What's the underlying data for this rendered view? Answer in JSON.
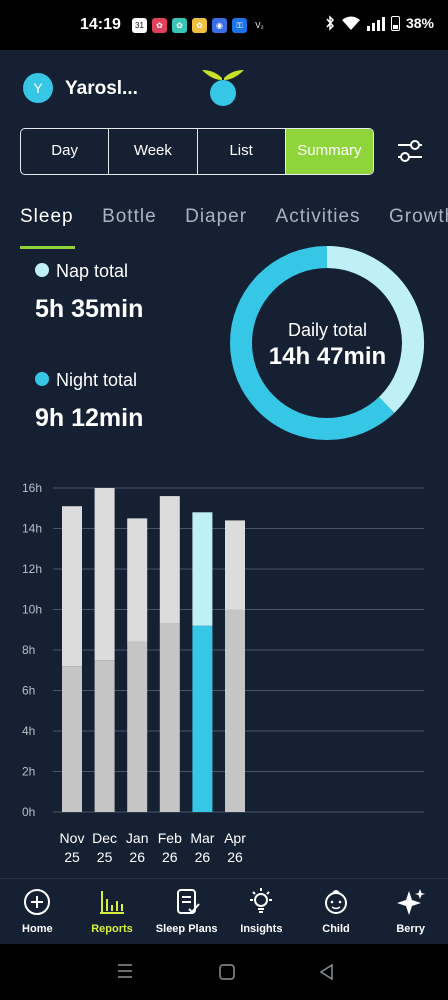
{
  "status": {
    "time": "14:19",
    "apps": [
      "31",
      "✿",
      "✿",
      "✿",
      "◉",
      "⚿",
      "V₂"
    ],
    "battery": "38%"
  },
  "header": {
    "avatar_letter": "Y",
    "child_name": "Yarosl..."
  },
  "periods": [
    "Day",
    "Week",
    "List",
    "Summary"
  ],
  "selected_period": "Summary",
  "tabs": [
    "Sleep",
    "Bottle",
    "Diaper",
    "Activities",
    "Growth"
  ],
  "selected_tab": "Sleep",
  "totals": {
    "nap_label": "Nap total",
    "nap_value": "5h 35min",
    "night_label": "Night total",
    "night_value": "9h 12min",
    "daily_label": "Daily total",
    "daily_value": "14h 47min"
  },
  "colors": {
    "background": "#162033",
    "nap": "#bff0f8",
    "night": "#36c7e6",
    "accent": "#8ed43a",
    "past_bar_top": "#dcdcdc",
    "past_bar_bottom": "#c5c5c5"
  },
  "chart_data": {
    "type": "bar",
    "stacked": true,
    "categories": [
      "Nov 25",
      "Dec 25",
      "Jan 26",
      "Feb 26",
      "Mar 26",
      "Apr 26"
    ],
    "series": [
      {
        "values": [
          7.2,
          7.5,
          8.4,
          9.3,
          9.2,
          10.0
        ]
      },
      {
        "values": [
          7.9,
          8.5,
          6.1,
          6.3,
          5.6,
          4.4
        ]
      }
    ],
    "highlight_index": 4,
    "ylim": [
      0,
      16
    ],
    "yticks": [
      "0h",
      "2h",
      "4h",
      "6h",
      "8h",
      "10h",
      "12h",
      "14h",
      "16h"
    ],
    "grid": true
  },
  "nav": [
    {
      "label": "Home",
      "icon": "home-icon"
    },
    {
      "label": "Reports",
      "icon": "reports-icon"
    },
    {
      "label": "Sleep Plans",
      "icon": "sleep-plans-icon"
    },
    {
      "label": "Insights",
      "icon": "insights-icon"
    },
    {
      "label": "Child",
      "icon": "child-icon"
    },
    {
      "label": "Berry",
      "icon": "berry-icon"
    }
  ],
  "active_nav": "Reports"
}
